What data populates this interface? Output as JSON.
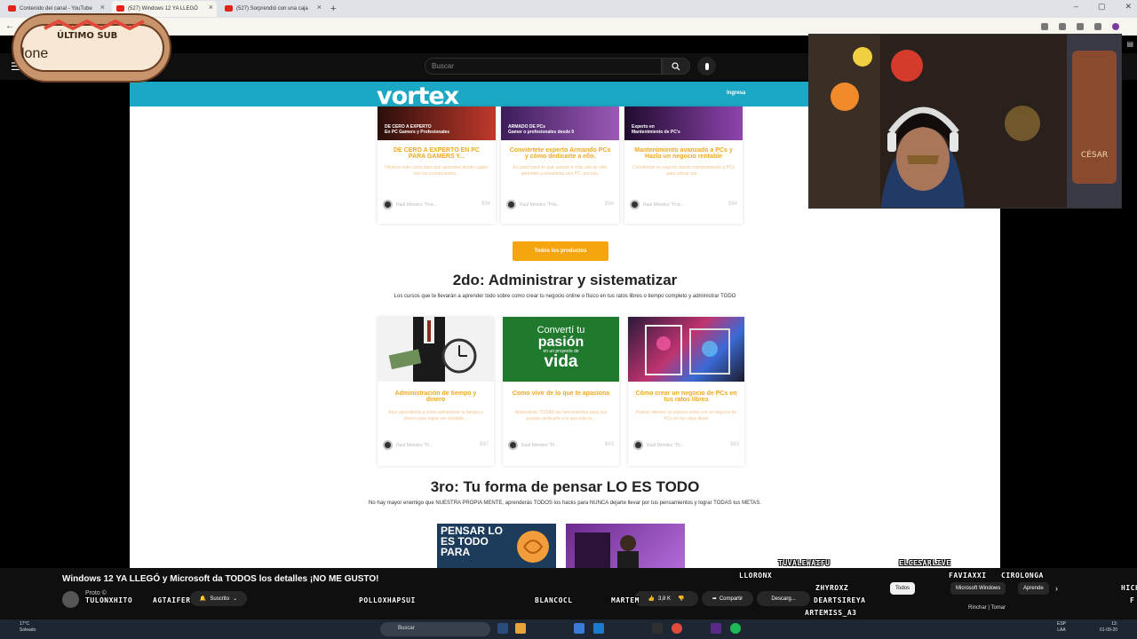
{
  "browser": {
    "tabs": [
      {
        "title": "Contenido del canal - YouTube"
      },
      {
        "title": "(527) Windows 12 YA LLEGÓ"
      },
      {
        "title": "(527) Sorprendió con una caja"
      }
    ]
  },
  "youtube": {
    "search_placeholder": "Buscar",
    "video_title": "Windows 12 YA LLEGÓ y Microsoft da TODOS los detalles ¡NO ME GUSTO!",
    "channel": "Proto ©",
    "subscribe_label": "Suscrito",
    "likes": "3,8 K",
    "share_label": "Compartir",
    "download_label": "Descarg...",
    "chips": [
      "Todos",
      "Microsoft Windows",
      "Aprende"
    ],
    "recommended_partial": "Rinchar | Tomar"
  },
  "site": {
    "logo": "vortex",
    "login": "Ingresa",
    "row1": [
      {
        "tag1": "DE CERO A EXPERTO",
        "tag2": "En PC Gamers y Profesionales",
        "title": "DE CERO A EXPERTO EN PC PARA GAMERS Y...",
        "desc": "Hicimos este curso para que aprendes desde cuales son los componentes...",
        "author": "Raúl Méndez \"Prot...",
        "price": "$94",
        "color": "#c0392b"
      },
      {
        "tag1": "ARMADO DE PCs",
        "tag2": "Gamer o profesionales desde 0",
        "title": "Conviértete experto Armando PCs y cómo dedicarte a ello.",
        "desc": "Es para todos lo que quieren ir más allá de sólo aprender a ensamblar una PC, por eso.",
        "author": "Raúl Méndez \"Prot...",
        "price": "$94",
        "color": "#7b3fa0"
      },
      {
        "tag1": "Experto en",
        "tag2": "Mantenimiento de PC's",
        "title": "Mantenimiento avanzado a PCs y Hazlo un negocio rentable",
        "desc": "Conviértete en experto dando mantenimiento a PCs para cobrar por...",
        "author": "Raúl Méndez \"Prot...",
        "price": "$94",
        "color": "#6a2d8a"
      }
    ],
    "all_products": "Todos los productos",
    "section2": {
      "title": "2do: Administrar y sistematizar",
      "subtitle": "Los cursos que te llevarán a aprender todo sobre como crear tu negocio online o físico en tus ratos libres o tiempo completo y administrar TODO",
      "cards": [
        {
          "title": "Administración de tiempo y dinero",
          "desc": "Aquí aprenderás a como administrar tu tiempo y dinero para lograr ser rentable...",
          "author": "Raúl Méndez \"Pr...",
          "price": "$97"
        },
        {
          "title": "Como vivir de lo que te apasiona",
          "desc": "Aprenderás TODAS las herramientas para que puedas dedicarte a lo que más te...",
          "author": "Raúl Méndez \"Pr...",
          "price": "$63",
          "img_line1": "Convertí tu",
          "img_line2": "pasión",
          "img_line3": "en un proyecto de",
          "img_line4": "vida"
        },
        {
          "title": "Cómo crear un negocio de PCs en tus ratos libres",
          "desc": "Podrás obtener un ingreso extra con un negocio de PCs en tus ratos libres",
          "author": "Raúl Méndez \"Pr...",
          "price": "$63"
        }
      ]
    },
    "section3": {
      "title": "3ro: Tu forma de pensar LO ES TODO",
      "subtitle": "No hay mayor enemigo que NUESTRA PROPIA MENTE, aprenderás TODOS los hacks para NUNCA dejarte llevar por tus pensamientos y lograr TODAS tus METAS.",
      "img_text": "PENSAR LO ES TODO PARA"
    }
  },
  "overlay": {
    "last_sub_label": "ÚLTIMO SUB",
    "last_sub_name": "lone",
    "chat_names": [
      "TULONXHITO",
      "AGTAIFER",
      "POLLOXHAPSUI",
      "BLANCOCL",
      "MARTEM",
      "LLORONX",
      "TUVALEWAIFU",
      "ELCESARLIVE",
      "FAVIAXXI",
      "CIROLONGA",
      "ZHYROXZ",
      "DEARTSIREYA",
      "ARTEMISS_A3",
      "HICH",
      "F"
    ]
  },
  "taskbar": {
    "weather_temp": "17°C",
    "weather_cond": "Soleado",
    "search": "Buscar",
    "lang1": "ESP",
    "lang2": "LAA",
    "time": "13:",
    "date": "01-09-20"
  }
}
